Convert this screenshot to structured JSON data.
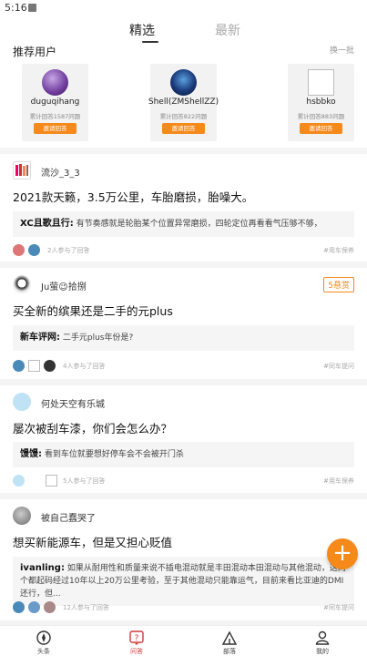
{
  "status_bar": {
    "time": "5:16"
  },
  "top_tabs": [
    {
      "label": "精选"
    },
    {
      "label": "最新"
    }
  ],
  "recommend": {
    "title": "推荐用户",
    "refresh": "换一批",
    "users": [
      {
        "name": "duguqihang",
        "stat": "累计回答1587问题",
        "invite": "邀请回答"
      },
      {
        "name": "Shell(ZMShellZZ)",
        "stat": "累计回答822问题",
        "invite": "邀请回答"
      },
      {
        "name": "hsbbko",
        "stat": "累计回答883问题",
        "invite": "邀请回答"
      }
    ]
  },
  "posts": [
    {
      "author": "流沙_3_3",
      "question": "2021款天籁，3.5万公里，车胎磨损，胎噪大。",
      "answer_user": "XC且歌且行:",
      "answer_text": "有节奏感就是轮胎某个位置异常磨损，四轮定位再看看气压够不够，",
      "participants": "2人参与了回答",
      "tag": "#用车保养"
    },
    {
      "author": "Ju萤😉拾捌",
      "bounty": "5悬赏",
      "question": "买全新的缤果还是二手的元plus",
      "answer_user": "新车评网:",
      "answer_text": "二手元plus年份是?",
      "participants": "4人参与了回答",
      "tag": "#同车提问"
    },
    {
      "author": "何处天空有乐城",
      "question": "屡次被刮车漆，你们会怎么办？",
      "answer_user": "馒馒:",
      "answer_text": "看到车位就要想好停车会不会被开门杀",
      "participants": "5人参与了回答",
      "tag": "#用车保养"
    },
    {
      "author": "被自己蠢哭了",
      "question": "想买新能源车，但是又担心贬值",
      "answer_user": "ivanling:",
      "answer_text": "如果从耐用性和质量来说不插电混动就是丰田混动本田混动与其他混动，这两个都起码经过10年以上20万公里考验，至于其他混动只能靠运气，目前来看比亚迪的DMI还行，但...",
      "participants": "12人参与了回答",
      "tag": "#同车提问"
    }
  ],
  "fab": {
    "label": "+"
  },
  "bottom_nav": [
    {
      "label": "头条",
      "icon": "compass-icon"
    },
    {
      "label": "问答",
      "icon": "question-icon"
    },
    {
      "label": "部落",
      "icon": "tent-icon"
    },
    {
      "label": "我的",
      "icon": "person-icon"
    }
  ],
  "colors": {
    "accent": "#f5891a",
    "active_nav": "#d13a3a"
  }
}
